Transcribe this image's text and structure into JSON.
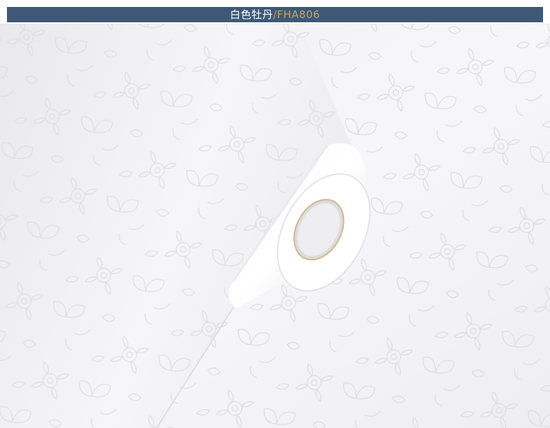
{
  "banner": {
    "product_name": "白色牡丹",
    "separator": "/",
    "product_code": "FHA806"
  },
  "colors": {
    "banner_background": "#3e5876",
    "banner_text": "#ffffff",
    "banner_accent": "#c9a46a",
    "wallpaper_base": "#f4f4f6",
    "wallpaper_pattern": "#e2e3e8",
    "roll_core_rim": "#d7b98c"
  },
  "photo": {
    "subject": "wallpaper-roll-icon"
  }
}
